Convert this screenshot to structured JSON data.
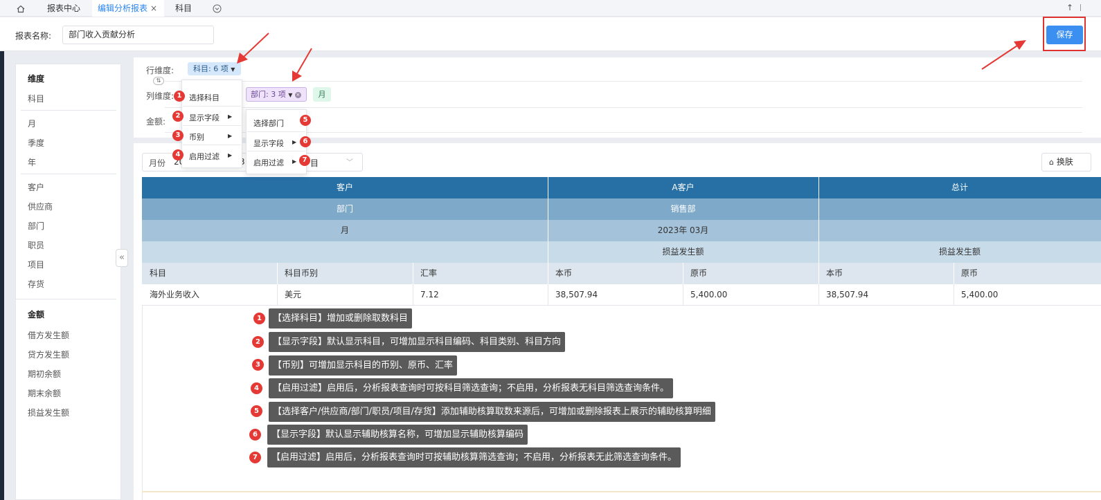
{
  "tabs": {
    "home_icon": "home-icon",
    "items": [
      "报表中心",
      "编辑分析报表",
      "科目"
    ],
    "close": "×",
    "more_icon": "chevron-circle-icon"
  },
  "header": {
    "name_label": "报表名称:",
    "name_value": "部门收入贡献分析",
    "save": "保存"
  },
  "sidebar": {
    "dim_head": "维度",
    "g1": [
      "科目"
    ],
    "g2": [
      "月",
      "季度",
      "年"
    ],
    "g3": [
      "客户",
      "供应商",
      "部门",
      "职员",
      "项目",
      "存货"
    ],
    "amt_head": "金额",
    "g4": [
      "借方发生额",
      "贷方发生额",
      "期初余额",
      "期末余额",
      "损益发生额"
    ],
    "collapse": "«"
  },
  "dims": {
    "row_label": "行维度:",
    "col_label": "列维度:",
    "amt_label": "金额:",
    "row_chip": "科目: 6 项",
    "col_chip": "部门: 3 项",
    "month_chip": "月",
    "toggle": "⇅"
  },
  "menu1": [
    "选择科目",
    "显示字段",
    "币别",
    "启用过滤"
  ],
  "menu2": [
    "选择部门",
    "显示字段",
    "启用过滤"
  ],
  "filter": {
    "label": "月份",
    "value_a": "20",
    "value_b": "3",
    "value_c": "目"
  },
  "skin": "换肤",
  "table": {
    "h1": [
      "客户",
      "A客户",
      "总计"
    ],
    "h2": [
      "部门",
      "销售部",
      ""
    ],
    "h3": [
      "月",
      "2023年 03月",
      ""
    ],
    "h4": [
      "",
      "损益发生额",
      "损益发生额"
    ],
    "h5": [
      "科目",
      "科目币别",
      "汇率",
      "本币",
      "原币",
      "本币",
      "原币"
    ],
    "row": [
      "海外业务收入",
      "美元",
      "7.12",
      "38,507.94",
      "5,400.00",
      "38,507.94",
      "5,400.00"
    ]
  },
  "notes": [
    "【选择科目】增加或删除取数科目",
    "【显示字段】默认显示科目，可增加显示科目编码、科目类别、科目方向",
    "【币别】可增加显示科目的币别、原币、汇率",
    "【启用过滤】启用后，分析报表查询时可按科目筛选查询；不启用，分析报表无科目筛选查询条件。",
    "【选择客户/供应商/部门/职员/项目/存货】添加辅助核算取数来源后，可增加或删除报表上展示的辅助核算明细",
    "【显示字段】默认显示辅助核算名称，可增加显示辅助核算编码",
    "【启用过滤】启用后，分析报表查询时可按辅助核算筛选查询；不启用，分析报表无此筛选查询条件。"
  ],
  "numbers": [
    "1",
    "2",
    "3",
    "4",
    "5",
    "6",
    "7"
  ],
  "colors": {
    "accent": "#3b8ff1",
    "badge": "#e53935",
    "header_dark": "#2670a6",
    "arrow": "#e53935"
  }
}
